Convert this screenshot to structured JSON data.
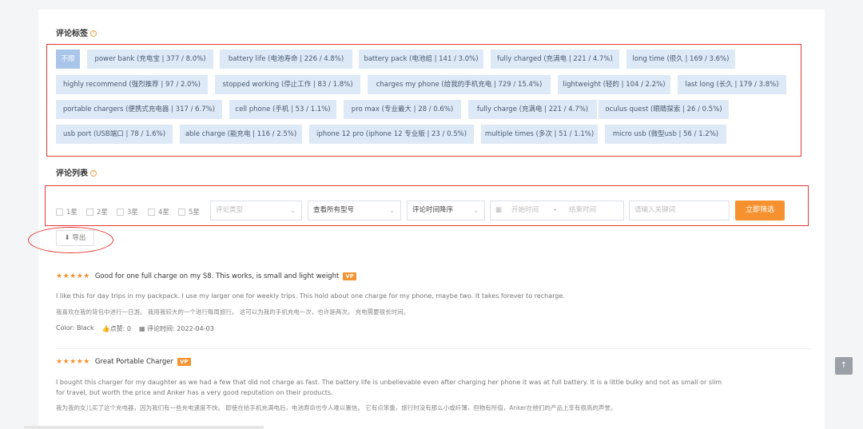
{
  "tags_section": {
    "title": "评论标签",
    "help_icon": "question-circle-icon"
  },
  "tag_rows": [
    [
      "不限",
      "power bank (充电宝 | 377 / 8.0%)",
      "battery life (电池寿命 | 226 / 4.8%)",
      "battery pack (电池组 | 141 / 3.0%)",
      "fully charged (充满电 | 221 / 4.7%)",
      "long time (很久 | 169 / 3.6%)"
    ],
    [
      "highly recommend (强烈推荐 | 97 / 2.0%)",
      "stopped working (停止工作 | 83 / 1.8%)",
      "charges my phone (给我的手机充电 | 729 / 15.4%)",
      "lightweight (轻的 | 104 / 2.2%)",
      "last long (长久 | 179 / 3.8%)"
    ],
    [
      "portable chargers (便携式充电器 | 317 / 6.7%)",
      "cell phone (手机 | 53 / 1.1%)",
      "pro max (专业最大 | 28 / 0.6%)",
      "fully charge (充满电 | 221 / 4.7%)",
      "oculus quest (眼睛探索 | 26 / 0.5%)"
    ],
    [
      "usb port (USB端口 | 78 / 1.6%)",
      "able charge (能充电 | 116 / 2.5%)",
      "iphone 12 pro (iphone 12 专业版 | 23 / 0.5%)",
      "multiple times (多次 | 51 / 1.1%)",
      "micro usb (微型usb | 56 / 1.2%)"
    ]
  ],
  "list_section": {
    "title": "评论列表"
  },
  "filters": {
    "stars": [
      "1星",
      "2星",
      "3星",
      "4星",
      "5星"
    ],
    "type_placeholder": "评论类型",
    "model_value": "查看所有型号",
    "sort_value": "评论时间降序",
    "start_placeholder": "开始时间",
    "range_sep": "-",
    "end_placeholder": "结束时间",
    "keyword_placeholder": "请输入关键词",
    "submit_label": "立即筛选"
  },
  "export_label": "导出",
  "reviews": [
    {
      "stars": "★★★★★",
      "title": "Good for one full charge on my S8. This works, is small and light weight",
      "badge": "VP",
      "text_en": "I like this for day trips in my packpack. I use my larger one for weekly trips. This hold about one charge for my phone, maybe two. It takes forever to recharge.",
      "text_zh": "我喜欢在我的背包中进行一日游。 我用我较大的一个进行每周旅行。 这可以为我的手机充电一次，也许是两次。 充电需要很长时间。",
      "color": "Color: Black",
      "likes": "点赞: 0",
      "date": "评论时间: 2022-04-03"
    },
    {
      "stars": "★★★★★",
      "title": "Great Portable Charger",
      "badge": "VP",
      "text_en_1": "I bought this charger for my daughter as we had a few that did not charge as fast. The battery life is unbelievable even after charging her phone it was at full battery. It is a little bulky and not as small or slim",
      "text_en_2": "for travel, but worth the price and Anker has a very good reputation on their products.",
      "text_zh": "我为我的女儿买了这个充电器，因为我们有一些充电速度不快。 即使在给手机充满电后，电池寿命也令人难以置信。 它有点笨重，旅行时没有那么小或纤薄，但物有所值，Anker在他们的产品上享有很高的声誉。"
    }
  ],
  "scroll_top_icon": "arrow-up-icon",
  "colors": {
    "accent": "#f5922f",
    "tag_bg": "#dde9f6",
    "tag_active": "#a9c6ea",
    "annotation_red": "#e53935"
  }
}
